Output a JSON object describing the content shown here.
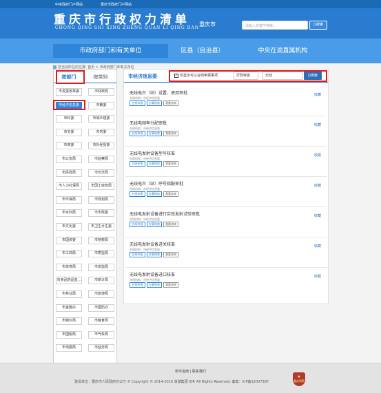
{
  "topbar": {
    "left_link": "中央政府门户网站",
    "right_link": "重庆市政府门户网站"
  },
  "header": {
    "logo_cn": "重庆市行政权力清单",
    "logo_pinyin": "CHONG QING SHI  XING ZHENG QUAN LI QING DAN",
    "city": "重庆市",
    "search_placeholder": "请输入关键字搜索...",
    "search_button": "Q搜索"
  },
  "nav": [
    "市政府部门和有关单位",
    "区县（自治县）",
    "中央在渝直属机构"
  ],
  "breadcrumb": {
    "prefix": "您当前所在的位置:",
    "home": "首页",
    "sep": ">",
    "current": "市政府部门和有关单位"
  },
  "sidebar": {
    "tabs": [
      "按部门",
      "按类别"
    ],
    "departments": [
      "市发展改革委",
      "市财政局",
      "市经济信息委",
      "市教委",
      "市科委",
      "市城乡建委",
      "市交委",
      "市农委",
      "市商委",
      "市外经贸委",
      "市公安局",
      "市监察局",
      "市民政局",
      "市司法局",
      "市人力社保局",
      "市国土房管局",
      "市环保局",
      "市规划局",
      "市水利局",
      "市市政委",
      "市文化委",
      "市卫生计生委",
      "市国资委",
      "市地税局",
      "市工商局",
      "市质监局",
      "市体育局",
      "市安监局",
      "市食品药品监...",
      "市统计局",
      "市林业局",
      "市旅游局",
      "市金融办",
      "市国防办",
      "市物价局",
      "市粮食局",
      "市国税局",
      "市气象局",
      "市地震局",
      "市盐务局"
    ]
  },
  "main": {
    "title": "市经济信息委",
    "filter_label": "仅显示可以在线申报事项",
    "filter_checkmark": "✓",
    "filter_select": "行政审批",
    "filter_input": "无线",
    "search_button": "Q搜索",
    "items": [
      {
        "title": "无线电台（站）设置、使用审批",
        "org": "办理机构：市经济信息委",
        "buttons": [
          "在线申报",
          "办事指南",
          "我要咨询"
        ],
        "fav": "收藏"
      },
      {
        "title": "无线电频率分配审批",
        "org": "办理机构：市经济信息委",
        "buttons": [
          "在线申报",
          "办事指南",
          "我要咨询"
        ],
        "fav": "收藏"
      },
      {
        "title": "无线电发射设备型号核准",
        "org": "办理机构：市经济信息委",
        "buttons": [
          "在线申报",
          "办事指南",
          "我要咨询"
        ],
        "fav": "收藏"
      },
      {
        "title": "无线电台（站）呼号指配审批",
        "org": "办理机构：市经济信息委",
        "buttons": [
          "在线申报",
          "办事指南",
          "我要咨询"
        ],
        "fav": "收藏"
      },
      {
        "title": "无线电发射设备进行实效发射试验审批",
        "org": "办理机构：市经济信息委",
        "buttons": [
          "在线申报",
          "办事指南",
          "我要咨询"
        ],
        "fav": "收藏"
      },
      {
        "title": "无线电发射设备进关核准",
        "org": "办理机构：市经济信息委",
        "buttons": [
          "在线申报",
          "办事指南",
          "我要咨询"
        ],
        "fav": "收藏"
      },
      {
        "title": "无线电发射设备进口核准",
        "org": "办理机构：市经济信息委",
        "buttons": [
          "在线申报",
          "办事指南",
          "我要咨询"
        ],
        "fav": "收藏"
      }
    ]
  },
  "footer": {
    "links": "新手指南 | 联系我们",
    "copyright": "建设单位：重庆市人民政府办公厅  © Copyright © 2014-2016 浪潮集团 IOP. All Rights Reserved.   备案：ICP备12007387",
    "badge_text": "重庆网警"
  },
  "colors": {
    "header": "#2a7cd1",
    "nav": "#4a9be8",
    "accent": "#2a75c9",
    "highlight": "#e0191b"
  }
}
